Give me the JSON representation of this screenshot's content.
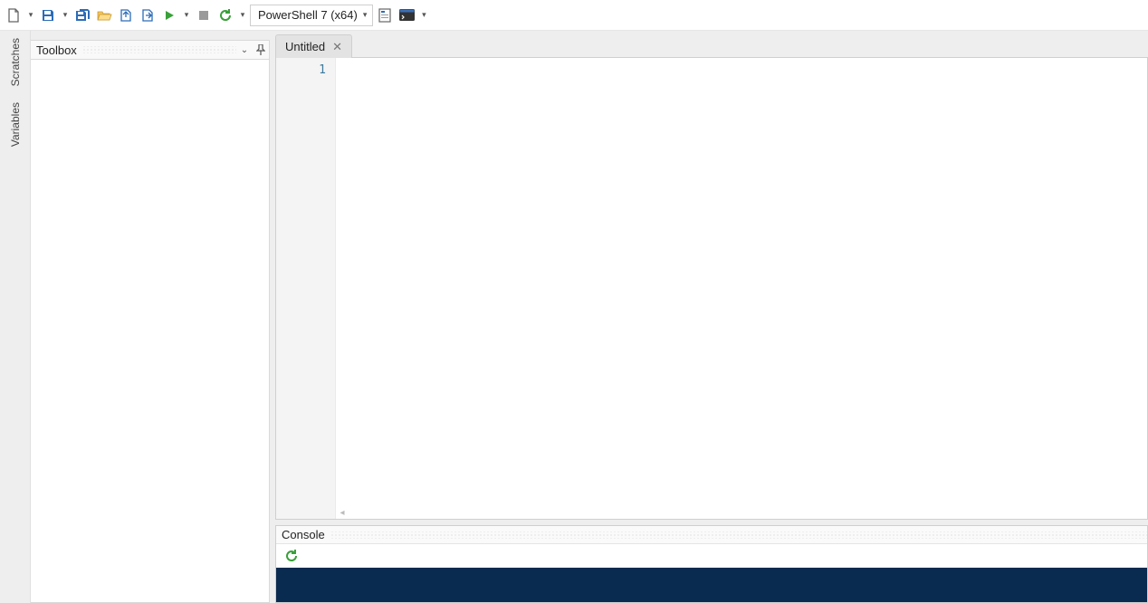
{
  "toolbar": {
    "runtime_selector": "PowerShell 7 (x64)"
  },
  "side_tabs": {
    "scratches": "Scratches",
    "variables": "Variables"
  },
  "toolbox": {
    "title": "Toolbox"
  },
  "editor": {
    "tab_label": "Untitled",
    "line_numbers": [
      "1"
    ]
  },
  "console": {
    "title": "Console"
  }
}
